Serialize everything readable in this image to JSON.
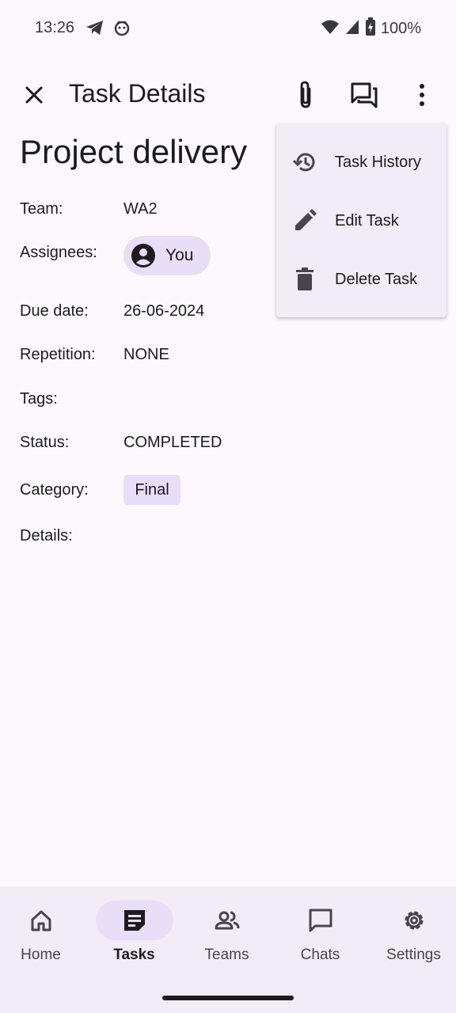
{
  "status_bar": {
    "time": "13:26",
    "battery": "100%",
    "icons": [
      "telegram-icon",
      "android-face-icon",
      "wifi-icon",
      "signal-icon",
      "battery-icon"
    ]
  },
  "app_bar": {
    "title": "Task Details",
    "icons": [
      "close-icon",
      "attach-icon",
      "forum-icon",
      "more-vert-icon"
    ]
  },
  "task": {
    "title": "Project delivery",
    "labels": {
      "team": "Team:",
      "assignees": "Assignees:",
      "due_date": "Due date:",
      "repetition": "Repetition:",
      "tags": "Tags:",
      "status": "Status:",
      "category": "Category:",
      "details": "Details:"
    },
    "team": "WA2",
    "assignee": "You",
    "due_date": "26-06-2024",
    "repetition": "NONE",
    "status": "COMPLETED",
    "category": "Final"
  },
  "menu": {
    "items": [
      {
        "label": "Task History",
        "icon": "history-icon"
      },
      {
        "label": "Edit Task",
        "icon": "edit-icon"
      },
      {
        "label": "Delete Task",
        "icon": "delete-icon"
      }
    ]
  },
  "bottom_nav": {
    "items": [
      {
        "label": "Home",
        "icon": "home-icon"
      },
      {
        "label": "Tasks",
        "icon": "tasks-icon",
        "active": true
      },
      {
        "label": "Teams",
        "icon": "teams-icon"
      },
      {
        "label": "Chats",
        "icon": "chat-icon"
      },
      {
        "label": "Settings",
        "icon": "settings-icon"
      }
    ]
  },
  "colors": {
    "background": "#fdf8fd",
    "chip": "#e8def8",
    "menu_surface": "#f1ecf5",
    "nav_surface": "#f2ecf6",
    "text": "#1d1b20"
  }
}
